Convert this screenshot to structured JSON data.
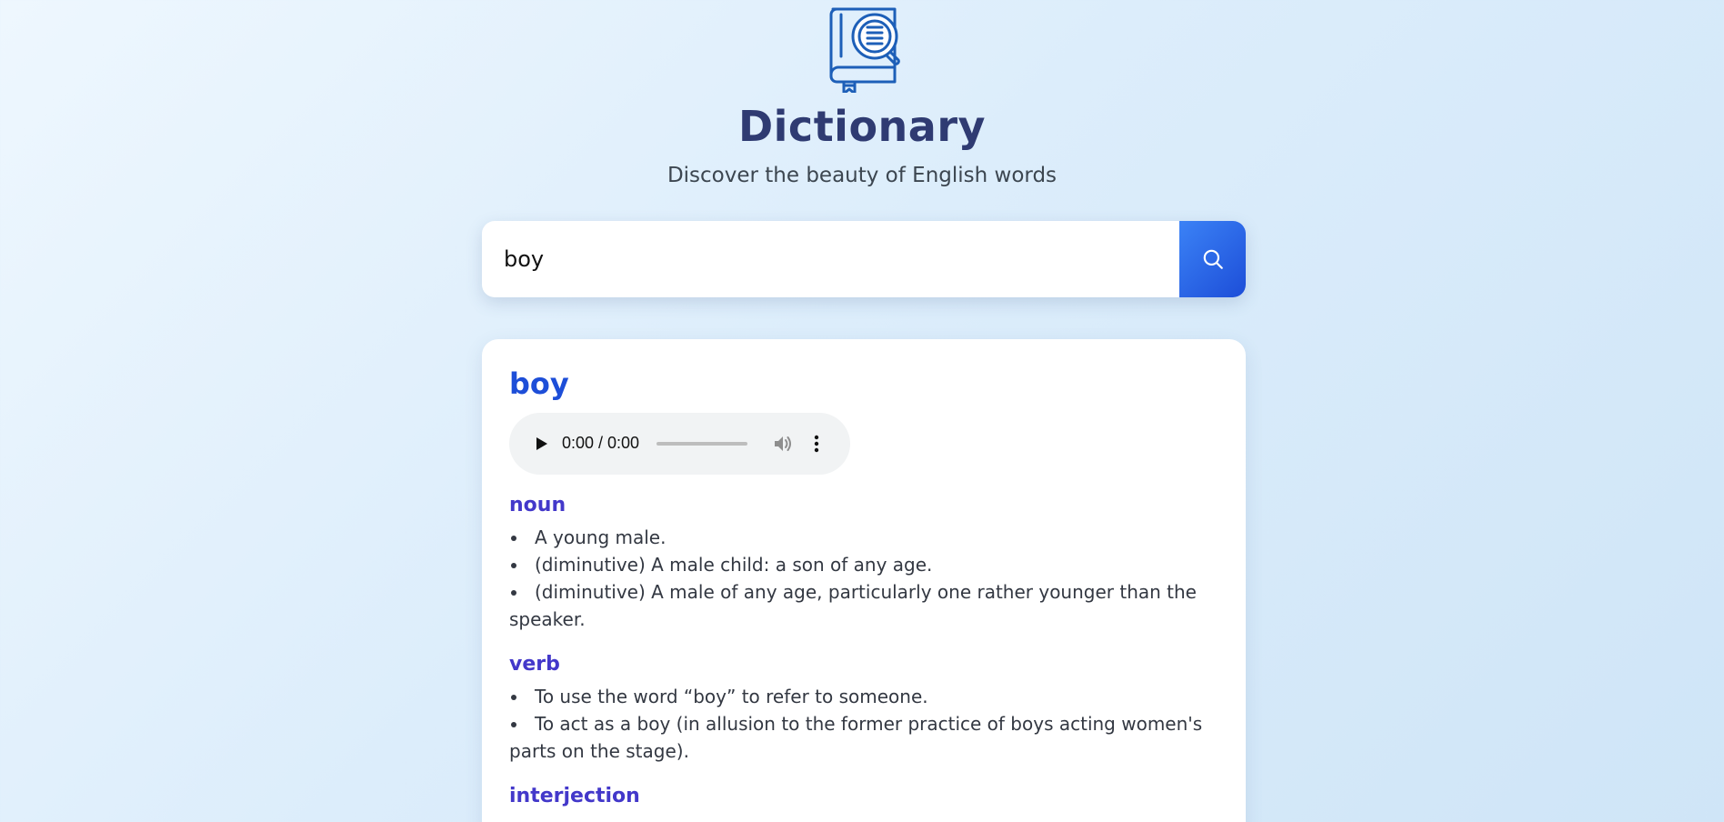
{
  "header": {
    "logo_icon": "dictionary-book-icon",
    "title": "Dictionary",
    "subtitle": "Discover the beauty of English words"
  },
  "search": {
    "value": "boy",
    "button_icon": "search-icon"
  },
  "result": {
    "word": "boy",
    "audio": {
      "time": "0:00 / 0:00",
      "progress": 0
    },
    "meanings": [
      {
        "part_of_speech": "noun",
        "definitions": [
          "A young male.",
          "(diminutive) A male child: a son of any age.",
          "(diminutive) A male of any age, particularly one rather younger than the speaker."
        ]
      },
      {
        "part_of_speech": "verb",
        "definitions": [
          "To use the word “boy” to refer to someone.",
          "To act as a boy (in allusion to the former practice of boys acting women's parts on the stage)."
        ]
      },
      {
        "part_of_speech": "interjection",
        "definitions": []
      }
    ]
  },
  "colors": {
    "title": "#2f3b72",
    "accent": "#1d4ed8",
    "part_of_speech": "#4338ca",
    "logo": "#1d5fb8"
  }
}
